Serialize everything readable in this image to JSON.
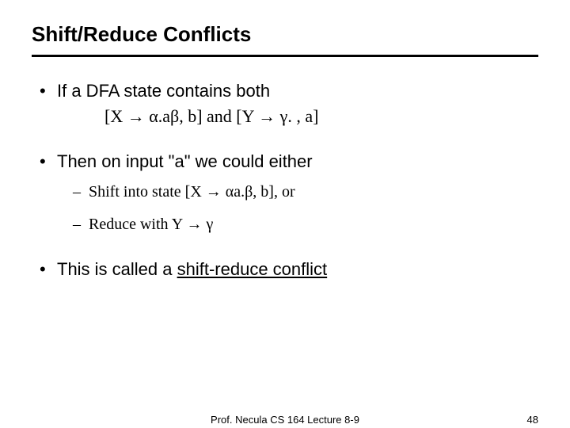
{
  "title": "Shift/Reduce Conflicts",
  "b1_lead": "If a DFA state contains both",
  "b1_items": "[X → α.aβ, b]  and  [Y → γ. , a]",
  "b2_lead": "Then on input \"a\" we could either",
  "b2_s1": "Shift into state [X → αa.β, b], or",
  "b2_s2": "Reduce with Y → γ",
  "b3_pre": "This is called a ",
  "b3_ul": "shift-reduce conflict",
  "footer_center": "Prof. Necula  CS 164  Lecture 8-9",
  "footer_right": "48"
}
